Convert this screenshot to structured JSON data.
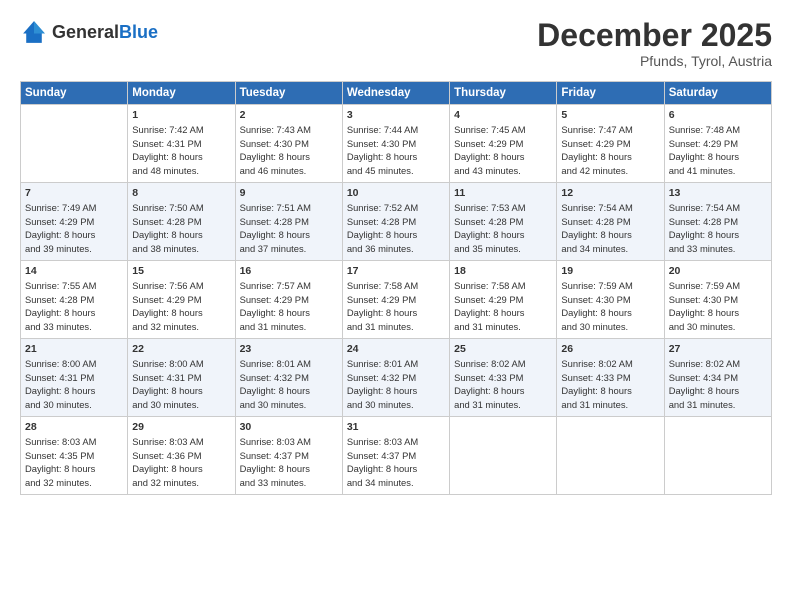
{
  "header": {
    "logo_general": "General",
    "logo_blue": "Blue",
    "month": "December 2025",
    "location": "Pfunds, Tyrol, Austria"
  },
  "days_of_week": [
    "Sunday",
    "Monday",
    "Tuesday",
    "Wednesday",
    "Thursday",
    "Friday",
    "Saturday"
  ],
  "weeks": [
    [
      {
        "day": "",
        "info": ""
      },
      {
        "day": "1",
        "info": "Sunrise: 7:42 AM\nSunset: 4:31 PM\nDaylight: 8 hours\nand 48 minutes."
      },
      {
        "day": "2",
        "info": "Sunrise: 7:43 AM\nSunset: 4:30 PM\nDaylight: 8 hours\nand 46 minutes."
      },
      {
        "day": "3",
        "info": "Sunrise: 7:44 AM\nSunset: 4:30 PM\nDaylight: 8 hours\nand 45 minutes."
      },
      {
        "day": "4",
        "info": "Sunrise: 7:45 AM\nSunset: 4:29 PM\nDaylight: 8 hours\nand 43 minutes."
      },
      {
        "day": "5",
        "info": "Sunrise: 7:47 AM\nSunset: 4:29 PM\nDaylight: 8 hours\nand 42 minutes."
      },
      {
        "day": "6",
        "info": "Sunrise: 7:48 AM\nSunset: 4:29 PM\nDaylight: 8 hours\nand 41 minutes."
      }
    ],
    [
      {
        "day": "7",
        "info": "Sunrise: 7:49 AM\nSunset: 4:29 PM\nDaylight: 8 hours\nand 39 minutes."
      },
      {
        "day": "8",
        "info": "Sunrise: 7:50 AM\nSunset: 4:28 PM\nDaylight: 8 hours\nand 38 minutes."
      },
      {
        "day": "9",
        "info": "Sunrise: 7:51 AM\nSunset: 4:28 PM\nDaylight: 8 hours\nand 37 minutes."
      },
      {
        "day": "10",
        "info": "Sunrise: 7:52 AM\nSunset: 4:28 PM\nDaylight: 8 hours\nand 36 minutes."
      },
      {
        "day": "11",
        "info": "Sunrise: 7:53 AM\nSunset: 4:28 PM\nDaylight: 8 hours\nand 35 minutes."
      },
      {
        "day": "12",
        "info": "Sunrise: 7:54 AM\nSunset: 4:28 PM\nDaylight: 8 hours\nand 34 minutes."
      },
      {
        "day": "13",
        "info": "Sunrise: 7:54 AM\nSunset: 4:28 PM\nDaylight: 8 hours\nand 33 minutes."
      }
    ],
    [
      {
        "day": "14",
        "info": "Sunrise: 7:55 AM\nSunset: 4:28 PM\nDaylight: 8 hours\nand 33 minutes."
      },
      {
        "day": "15",
        "info": "Sunrise: 7:56 AM\nSunset: 4:29 PM\nDaylight: 8 hours\nand 32 minutes."
      },
      {
        "day": "16",
        "info": "Sunrise: 7:57 AM\nSunset: 4:29 PM\nDaylight: 8 hours\nand 31 minutes."
      },
      {
        "day": "17",
        "info": "Sunrise: 7:58 AM\nSunset: 4:29 PM\nDaylight: 8 hours\nand 31 minutes."
      },
      {
        "day": "18",
        "info": "Sunrise: 7:58 AM\nSunset: 4:29 PM\nDaylight: 8 hours\nand 31 minutes."
      },
      {
        "day": "19",
        "info": "Sunrise: 7:59 AM\nSunset: 4:30 PM\nDaylight: 8 hours\nand 30 minutes."
      },
      {
        "day": "20",
        "info": "Sunrise: 7:59 AM\nSunset: 4:30 PM\nDaylight: 8 hours\nand 30 minutes."
      }
    ],
    [
      {
        "day": "21",
        "info": "Sunrise: 8:00 AM\nSunset: 4:31 PM\nDaylight: 8 hours\nand 30 minutes."
      },
      {
        "day": "22",
        "info": "Sunrise: 8:00 AM\nSunset: 4:31 PM\nDaylight: 8 hours\nand 30 minutes."
      },
      {
        "day": "23",
        "info": "Sunrise: 8:01 AM\nSunset: 4:32 PM\nDaylight: 8 hours\nand 30 minutes."
      },
      {
        "day": "24",
        "info": "Sunrise: 8:01 AM\nSunset: 4:32 PM\nDaylight: 8 hours\nand 30 minutes."
      },
      {
        "day": "25",
        "info": "Sunrise: 8:02 AM\nSunset: 4:33 PM\nDaylight: 8 hours\nand 31 minutes."
      },
      {
        "day": "26",
        "info": "Sunrise: 8:02 AM\nSunset: 4:33 PM\nDaylight: 8 hours\nand 31 minutes."
      },
      {
        "day": "27",
        "info": "Sunrise: 8:02 AM\nSunset: 4:34 PM\nDaylight: 8 hours\nand 31 minutes."
      }
    ],
    [
      {
        "day": "28",
        "info": "Sunrise: 8:03 AM\nSunset: 4:35 PM\nDaylight: 8 hours\nand 32 minutes."
      },
      {
        "day": "29",
        "info": "Sunrise: 8:03 AM\nSunset: 4:36 PM\nDaylight: 8 hours\nand 32 minutes."
      },
      {
        "day": "30",
        "info": "Sunrise: 8:03 AM\nSunset: 4:37 PM\nDaylight: 8 hours\nand 33 minutes."
      },
      {
        "day": "31",
        "info": "Sunrise: 8:03 AM\nSunset: 4:37 PM\nDaylight: 8 hours\nand 34 minutes."
      },
      {
        "day": "",
        "info": ""
      },
      {
        "day": "",
        "info": ""
      },
      {
        "day": "",
        "info": ""
      }
    ]
  ]
}
